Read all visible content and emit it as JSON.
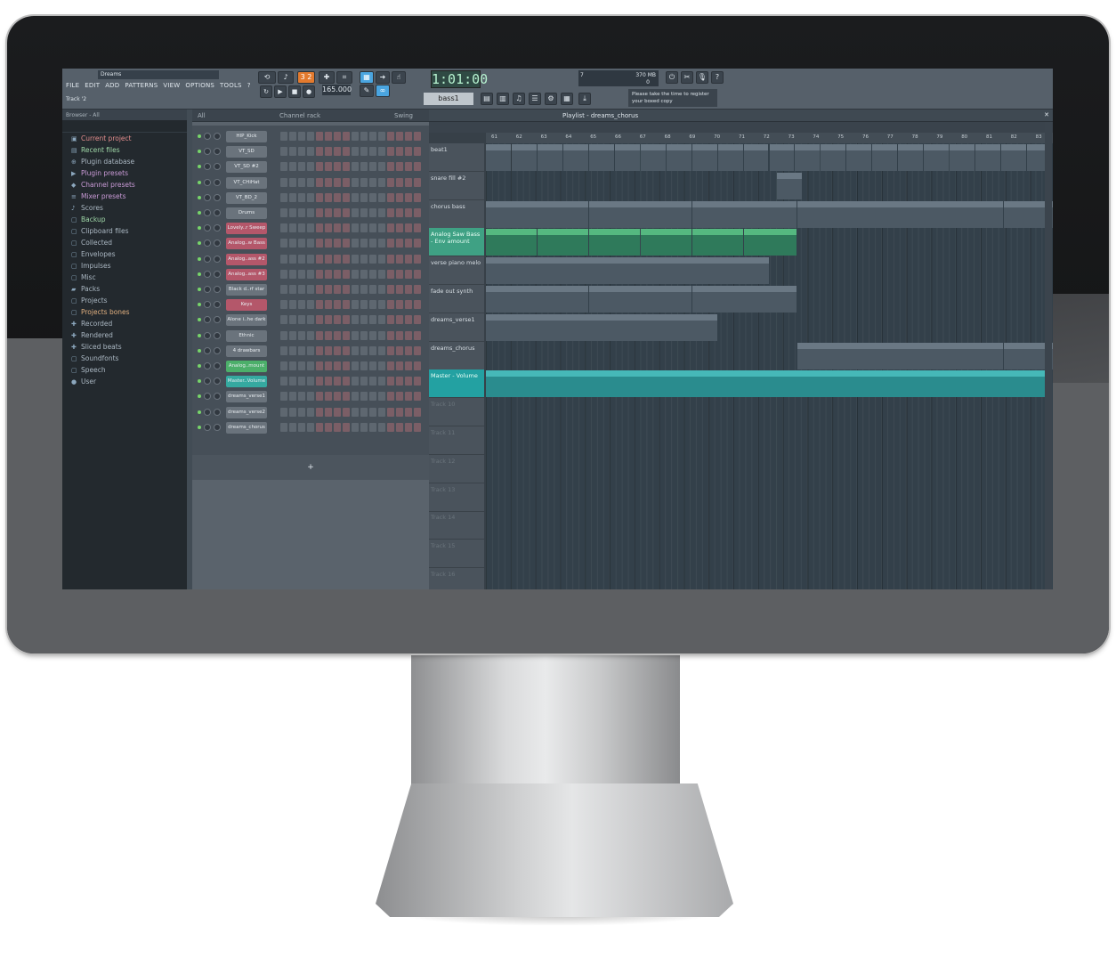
{
  "window": {
    "title": "Dreams",
    "hint": "Track '2"
  },
  "menu": [
    "FILE",
    "EDIT",
    "ADD",
    "PATTERNS",
    "VIEW",
    "OPTIONS",
    "TOOLS",
    "?"
  ],
  "transport": {
    "time": "1:01:00",
    "tempo": "165.000",
    "pattern": "bass1",
    "memory": "370 MB",
    "cpu": "7",
    "voices": "0",
    "message": "Please take the time to register your boxed copy"
  },
  "browser": {
    "header": "Browser - All",
    "items": [
      {
        "label": "Current project",
        "cls": "c1"
      },
      {
        "label": "Recent files",
        "cls": "c2"
      },
      {
        "label": "Plugin database",
        "cls": ""
      },
      {
        "label": "Plugin presets",
        "cls": "c3"
      },
      {
        "label": "Channel presets",
        "cls": "c3"
      },
      {
        "label": "Mixer presets",
        "cls": "c3"
      },
      {
        "label": "Scores",
        "cls": ""
      },
      {
        "label": "Backup",
        "cls": "c2"
      },
      {
        "label": "Clipboard files",
        "cls": ""
      },
      {
        "label": "Collected",
        "cls": ""
      },
      {
        "label": "Envelopes",
        "cls": ""
      },
      {
        "label": "Impulses",
        "cls": ""
      },
      {
        "label": "Misc",
        "cls": ""
      },
      {
        "label": "Packs",
        "cls": ""
      },
      {
        "label": "Projects",
        "cls": ""
      },
      {
        "label": "Projects bones",
        "cls": "c4"
      },
      {
        "label": "Recorded",
        "cls": ""
      },
      {
        "label": "Rendered",
        "cls": ""
      },
      {
        "label": "Sliced beats",
        "cls": ""
      },
      {
        "label": "Soundfonts",
        "cls": ""
      },
      {
        "label": "Speech",
        "cls": ""
      },
      {
        "label": "User",
        "cls": ""
      }
    ]
  },
  "rack": {
    "title": "Channel rack",
    "filter": "All",
    "swing": "Swing",
    "channels": [
      {
        "name": "HIP_Kick",
        "c": ""
      },
      {
        "name": "VT_SD",
        "c": ""
      },
      {
        "name": "VT_SD #2",
        "c": ""
      },
      {
        "name": "VT_CHiHat",
        "c": ""
      },
      {
        "name": "VT_BD_2",
        "c": ""
      },
      {
        "name": "Drums",
        "c": ""
      },
      {
        "name": "Lovely..r Sweep",
        "c": "pink"
      },
      {
        "name": "Analog..w Bass",
        "c": "pink"
      },
      {
        "name": "Analog..ass #2",
        "c": "pink"
      },
      {
        "name": "Analog..ass #3",
        "c": "pink"
      },
      {
        "name": "Black d..rf star",
        "c": ""
      },
      {
        "name": "Keys",
        "c": "pink"
      },
      {
        "name": "Alone i..he dark",
        "c": ""
      },
      {
        "name": "Ethnic",
        "c": ""
      },
      {
        "name": "4 drawbars",
        "c": ""
      },
      {
        "name": "Analog..mount",
        "c": "green"
      },
      {
        "name": "Master..Volume",
        "c": "cyan"
      },
      {
        "name": "dreams_verse1",
        "c": ""
      },
      {
        "name": "dreams_verse2",
        "c": ""
      },
      {
        "name": "dreams_chorus",
        "c": ""
      }
    ]
  },
  "playlist": {
    "title": "Playlist - dreams_chorus",
    "ruler": [
      "61",
      "62",
      "63",
      "64",
      "65",
      "66",
      "67",
      "68",
      "69",
      "70",
      "71",
      "72",
      "73",
      "74",
      "75",
      "76",
      "77",
      "78",
      "79",
      "80",
      "81",
      "82",
      "83"
    ],
    "tracks": [
      {
        "name": "beat1",
        "c": ""
      },
      {
        "name": "snare fill #2",
        "c": ""
      },
      {
        "name": "chorus bass",
        "c": ""
      },
      {
        "name": "Analog Saw Bass - Env amount",
        "c": "hl"
      },
      {
        "name": "verse piano melo",
        "c": ""
      },
      {
        "name": "fade out synth",
        "c": ""
      },
      {
        "name": "dreams_verse1",
        "c": ""
      },
      {
        "name": "dreams_chorus",
        "c": ""
      },
      {
        "name": "Master - Volume",
        "c": "hl2"
      },
      {
        "name": "Track 10",
        "c": "dim"
      },
      {
        "name": "Track 11",
        "c": "dim"
      },
      {
        "name": "Track 12",
        "c": "dim"
      },
      {
        "name": "Track 13",
        "c": "dim"
      },
      {
        "name": "Track 14",
        "c": "dim"
      },
      {
        "name": "Track 15",
        "c": "dim"
      },
      {
        "name": "Track 16",
        "c": "dim"
      }
    ],
    "clips": [
      {
        "label": "beat1",
        "row": 0,
        "s": 0,
        "w": 2
      },
      {
        "label": "beat1",
        "row": 0,
        "s": 2,
        "w": 2
      },
      {
        "label": "beat1",
        "row": 0,
        "s": 4,
        "w": 2
      },
      {
        "label": "be..sn",
        "row": 0,
        "s": 6,
        "w": 2
      },
      {
        "label": "beat1",
        "row": 0,
        "s": 8,
        "w": 2
      },
      {
        "label": "beat1",
        "row": 0,
        "s": 10,
        "w": 2
      },
      {
        "label": "beat1",
        "row": 0,
        "s": 12,
        "w": 2
      },
      {
        "label": "be..sn",
        "row": 0,
        "s": 14,
        "w": 2
      },
      {
        "label": "beat1",
        "row": 0,
        "s": 16,
        "w": 2
      },
      {
        "label": "beat1",
        "row": 0,
        "s": 18,
        "w": 2
      },
      {
        "label": "beat1",
        "row": 0,
        "s": 20,
        "w": 2
      },
      {
        "label": "be..sn",
        "row": 0,
        "s": 22,
        "w": 2
      },
      {
        "label": "be..ats",
        "row": 0,
        "s": 24,
        "w": 2
      },
      {
        "label": "be..ats",
        "row": 0,
        "s": 26,
        "w": 2
      },
      {
        "label": "be..ats",
        "row": 0,
        "s": 28,
        "w": 2
      },
      {
        "label": "be..ats",
        "row": 0,
        "s": 30,
        "w": 2
      },
      {
        "label": "be..ats",
        "row": 0,
        "s": 32,
        "w": 2
      },
      {
        "label": "be..ats",
        "row": 0,
        "s": 34,
        "w": 2
      },
      {
        "label": "be..ats",
        "row": 0,
        "s": 36,
        "w": 2
      },
      {
        "label": "be..ats",
        "row": 0,
        "s": 38,
        "w": 2
      },
      {
        "label": "be..ats",
        "row": 0,
        "s": 40,
        "w": 2
      },
      {
        "label": "be..ats",
        "row": 0,
        "s": 42,
        "w": 2
      },
      {
        "label": "sn..#2",
        "row": 1,
        "s": 22.6,
        "w": 2
      },
      {
        "label": "bass1",
        "row": 2,
        "s": 0,
        "w": 8
      },
      {
        "label": "bass1b",
        "row": 2,
        "s": 8,
        "w": 8
      },
      {
        "label": "bass1",
        "row": 2,
        "s": 16,
        "w": 8.2
      },
      {
        "label": "chorus bass",
        "row": 2,
        "s": 24.2,
        "w": 16
      },
      {
        "label": "chorus bass",
        "row": 2,
        "s": 40.2,
        "w": 4
      },
      {
        "label": "Analog..envelope",
        "row": 3,
        "s": 0,
        "w": 4,
        "c": "env"
      },
      {
        "label": "Analog..envelope",
        "row": 3,
        "s": 4,
        "w": 4,
        "c": "env"
      },
      {
        "label": "Analog..envelope",
        "row": 3,
        "s": 8,
        "w": 4,
        "c": "env"
      },
      {
        "label": "Analog..envelope",
        "row": 3,
        "s": 12,
        "w": 4,
        "c": "env"
      },
      {
        "label": "Analog..envelope",
        "row": 3,
        "s": 16,
        "w": 4,
        "c": "env"
      },
      {
        "label": "Analog..envelope",
        "row": 3,
        "s": 20,
        "w": 4.2,
        "c": "env"
      },
      {
        "label": "verse piano melo",
        "row": 4,
        "s": 0,
        "w": 22
      },
      {
        "label": "verse ambient 1",
        "row": 5,
        "s": 0,
        "w": 8
      },
      {
        "label": "verse ambient 2",
        "row": 5,
        "s": 8,
        "w": 8
      },
      {
        "label": "verse ambient 1",
        "row": 5,
        "s": 16,
        "w": 8.2
      },
      {
        "label": "dreams_verse2",
        "row": 6,
        "s": 0,
        "w": 18
      },
      {
        "label": "dreams_chorus",
        "row": 7,
        "s": 24.2,
        "w": 16
      },
      {
        "label": "dreams_chorus",
        "row": 7,
        "s": 40.2,
        "w": 4
      },
      {
        "label": "Master - Volume envelope",
        "row": 8,
        "s": 0,
        "w": 44,
        "c": "vol"
      }
    ]
  }
}
